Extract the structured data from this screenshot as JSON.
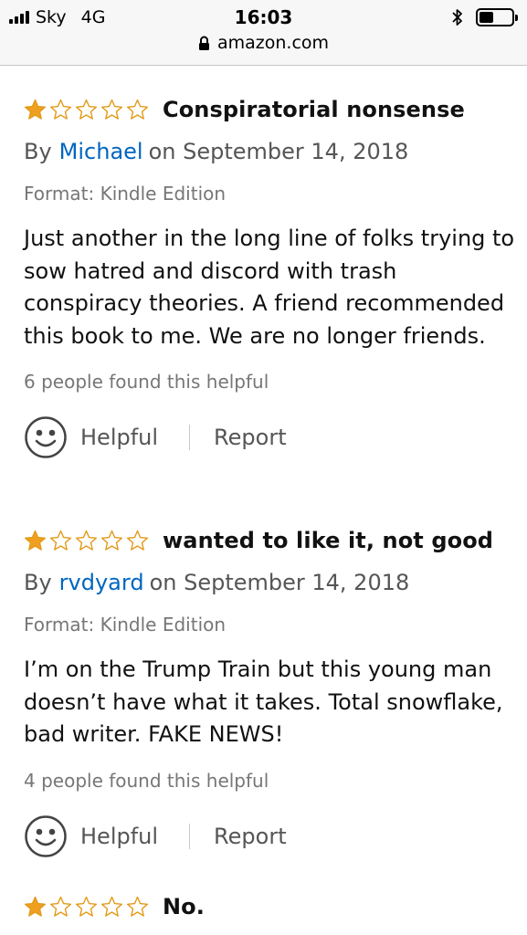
{
  "status_bar": {
    "carrier": "Sky",
    "network": "4G",
    "time": "16:03",
    "icons": [
      "signal-bars-icon",
      "bluetooth-icon",
      "battery-icon"
    ],
    "battery_level": 0.45
  },
  "url_bar": {
    "domain": "amazon.com",
    "icon": "lock-icon"
  },
  "colors": {
    "star_fill": "#f0a020",
    "star_outline": "#e29a18",
    "author_link": "#0066c0",
    "muted_text": "#767676"
  },
  "reviews": [
    {
      "rating": 1,
      "max_rating": 5,
      "title": "Conspiratorial nonsense",
      "by": "By",
      "author": "Michael",
      "date": "on September 14, 2018",
      "format": "Format: Kindle Edition",
      "body": "Just another in the long line of folks trying to sow hatred and discord with trash conspiracy theories. A friend recommended this book to me. We are no longer friends.",
      "helpful_count": "6 people found this helpful",
      "helpful_label": "Helpful",
      "report_label": "Report"
    },
    {
      "rating": 1,
      "max_rating": 5,
      "title": "wanted to like it, not good",
      "by": "By",
      "author": "rvdyard",
      "date": "on September 14, 2018",
      "format": "Format: Kindle Edition",
      "body": "I’m on the Trump Train but this young man doesn’t have what it takes. Total snowflake, bad writer. FAKE NEWS!",
      "helpful_count": "4 people found this helpful",
      "helpful_label": "Helpful",
      "report_label": "Report"
    },
    {
      "rating": 1,
      "max_rating": 5,
      "title": "No."
    }
  ]
}
